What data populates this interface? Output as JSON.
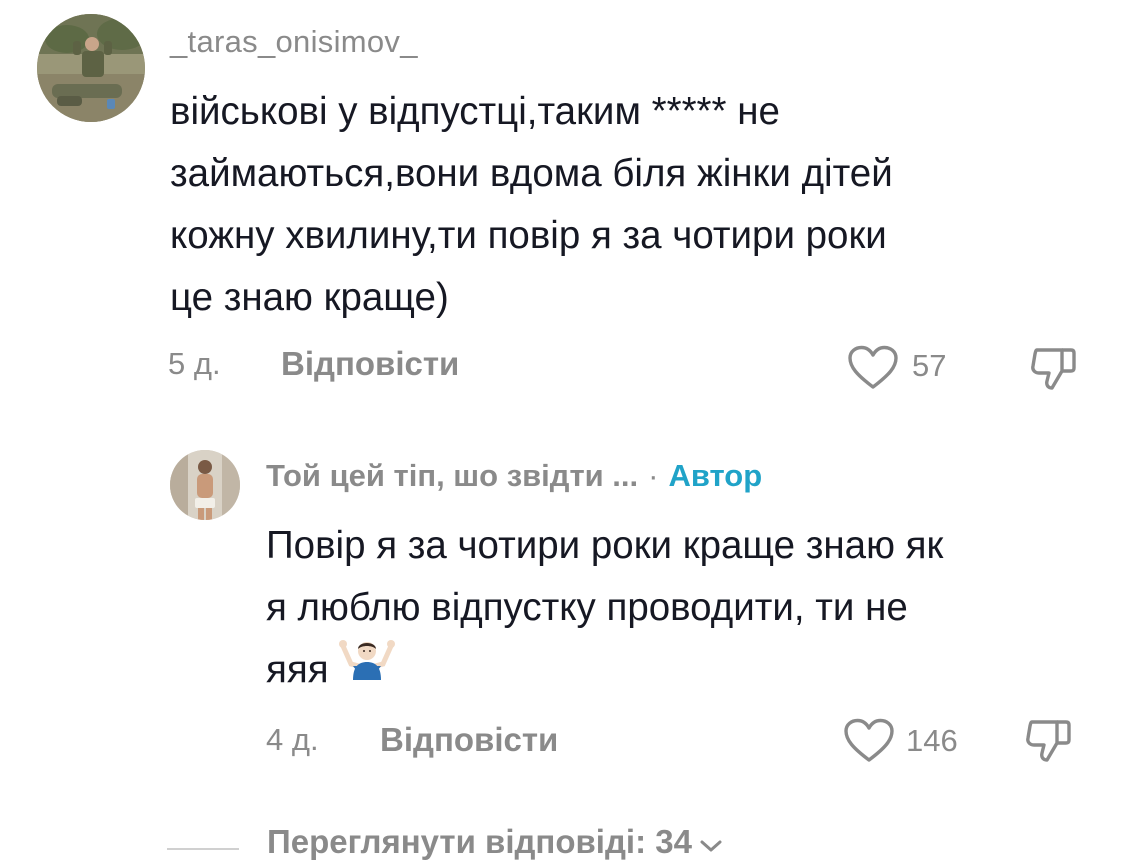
{
  "comment": {
    "username": "_taras_onisimov_",
    "text_lines": [
      "військові у відпустці,таким ***** не",
      "займаються,вони вдома біля жінки дітей",
      "кожну хвилину,ти повір я за чотири роки",
      "це знаю краще)"
    ],
    "time": "5 д.",
    "reply_label": "Відповісти",
    "like_count": "57",
    "avatar_icon": "user-photo-avatar"
  },
  "reply": {
    "username": "Той цей тіп, шо звідти ...",
    "separator": "·",
    "author_badge": "Автор",
    "author_badge_color": "#20a3c8",
    "text_lines": [
      "Повір я за чотири роки краще знаю як",
      "я люблю відпустку проводити, ти не",
      "яяя"
    ],
    "emoji": "man-shrugging-emoji",
    "time": "4 д.",
    "reply_label": "Відповісти",
    "like_count": "146",
    "avatar_icon": "user-photo-avatar"
  },
  "view_replies": {
    "label": "Переглянути відповіді: 34",
    "icon": "chevron-down-icon"
  },
  "colors": {
    "text": "#161823",
    "muted": "#8a8a8a",
    "accent": "#20a3c8",
    "background": "#ffffff"
  }
}
